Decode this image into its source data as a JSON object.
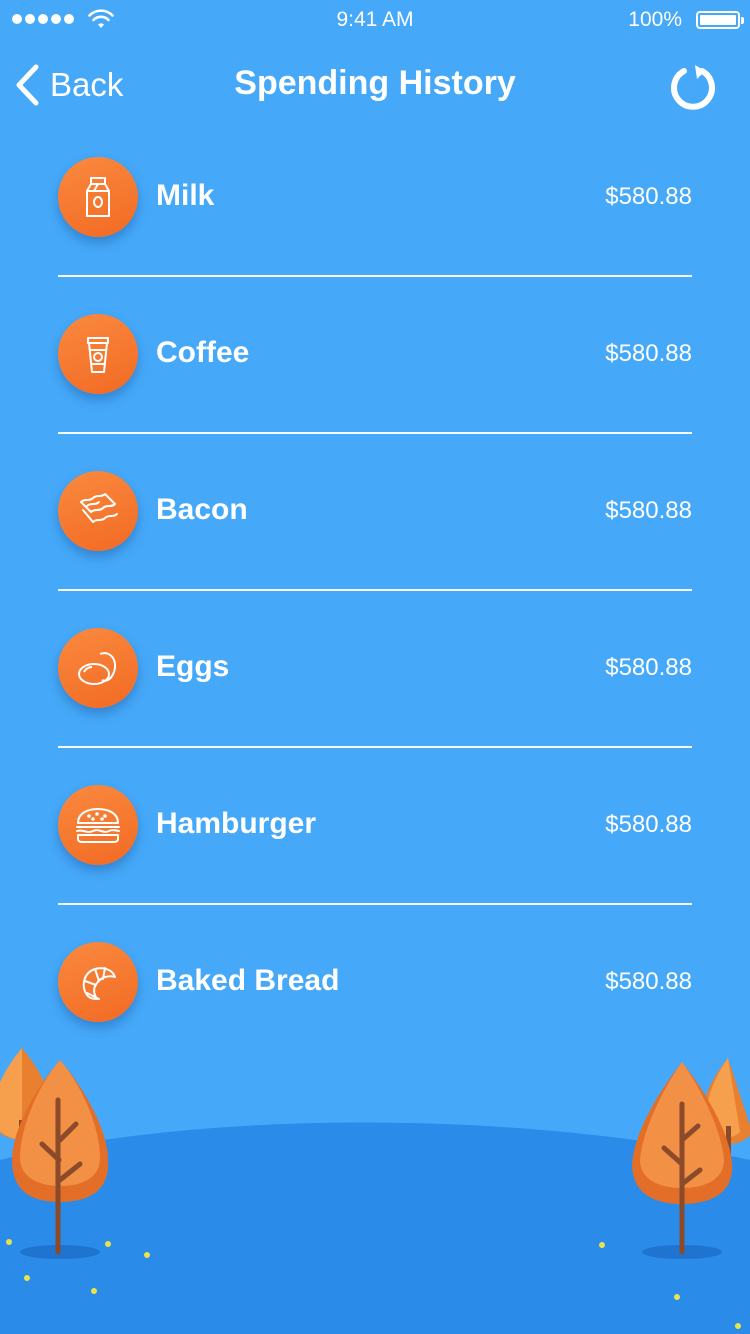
{
  "status_bar": {
    "time": "9:41 AM",
    "battery": "100%"
  },
  "nav": {
    "back_label": "Back",
    "title": "Spending History",
    "refresh_icon": "refresh-icon"
  },
  "items": [
    {
      "name": "Milk",
      "amount": "$580.88",
      "icon": "milk-carton-icon"
    },
    {
      "name": "Coffee",
      "amount": "$580.88",
      "icon": "coffee-cup-icon"
    },
    {
      "name": "Bacon",
      "amount": "$580.88",
      "icon": "bacon-icon"
    },
    {
      "name": "Eggs",
      "amount": "$580.88",
      "icon": "eggs-icon"
    },
    {
      "name": "Hamburger",
      "amount": "$580.88",
      "icon": "hamburger-icon"
    },
    {
      "name": "Baked Bread",
      "amount": "$580.88",
      "icon": "croissant-icon"
    }
  ],
  "colors": {
    "background": "#45a8f8",
    "ground": "#2a8be9",
    "accent": "#f47a30",
    "tree": "#f08a3a"
  }
}
